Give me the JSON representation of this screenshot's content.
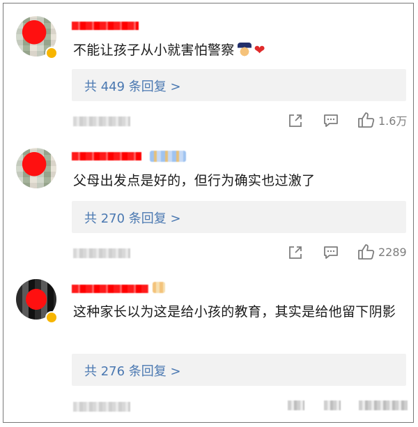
{
  "comments": [
    {
      "text": "不能让孩子从小就害怕警察",
      "replies_label": "共 449 条回复 >",
      "likes": "1.6万"
    },
    {
      "text": "父母出发点是好的，但行为确实也过激了",
      "replies_label": "共 270 条回复 >",
      "likes": "2289"
    },
    {
      "text": "这种家长以为这是给小孩的教育，其实是给他留下阴影",
      "replies_label": "共 276 条回复 >",
      "likes": ""
    }
  ],
  "icons": {
    "share": "share-icon",
    "comment": "comment-icon",
    "like": "thumbs-up-icon",
    "police_emoji": "police-officer-emoji",
    "heart_emoji": "red-heart-emoji"
  },
  "colors": {
    "reply_link": "#4a78b1",
    "reply_bg": "#f2f2f2",
    "action_gray": "#7d7d7d"
  }
}
